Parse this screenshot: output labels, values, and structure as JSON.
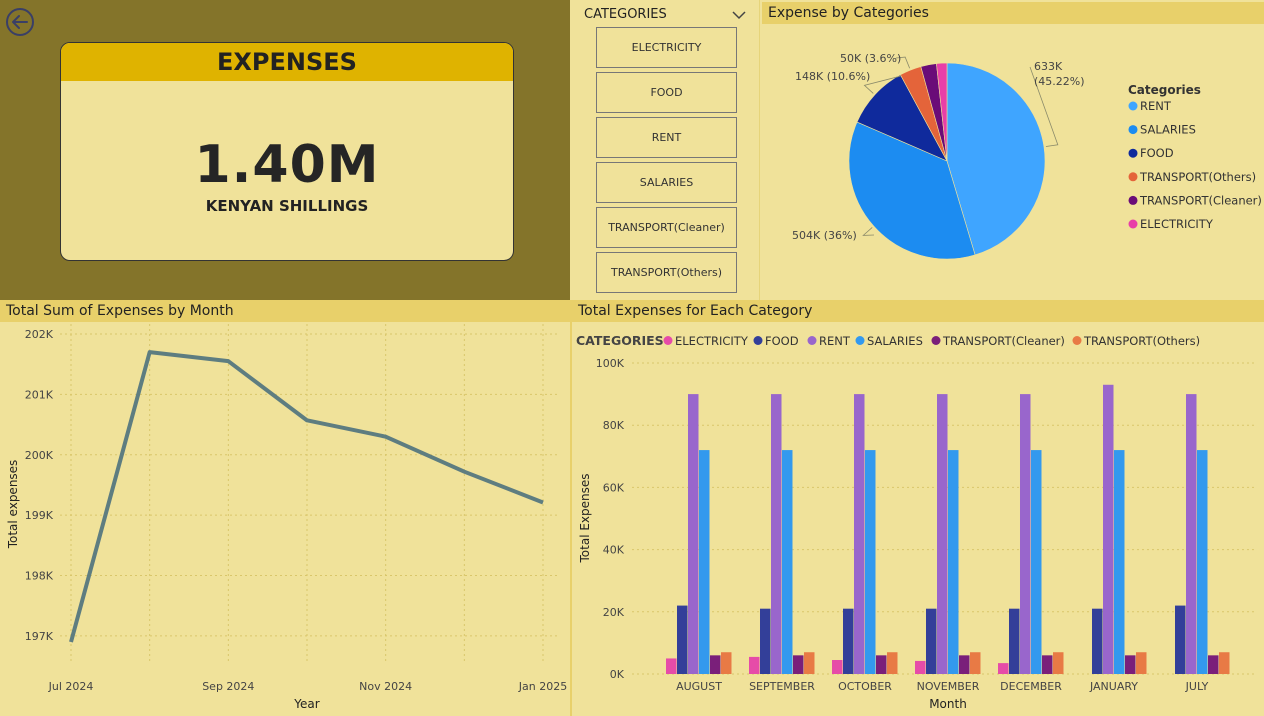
{
  "kpi": {
    "title": "EXPENSES",
    "value": "1.40M",
    "unit": "KENYAN SHILLINGS"
  },
  "slicer": {
    "title": "CATEGORIES",
    "items": [
      "ELECTRICITY",
      "FOOD",
      "RENT",
      "SALARIES",
      "TRANSPORT(Cleaner)",
      "TRANSPORT(Others)"
    ]
  },
  "icons": {
    "back": "back-arrow-icon",
    "chevron": "chevron-down-icon"
  },
  "colors": {
    "rent": "#9966cc",
    "salaries": "#3399ee",
    "food": "#333f99",
    "electricity": "#e64ca8",
    "transport_cleaner": "#7a1f7a",
    "transport_others": "#e87a45",
    "line": "#5e7d80",
    "pie_rent": "#3fa5ff",
    "pie_salaries": "#1c8cf1",
    "pie_food": "#0f2a9c",
    "pie_transport_others": "#e4643a",
    "pie_transport_cleaner": "#6a0c78",
    "pie_electricity": "#e83fa8"
  },
  "panels": {
    "pie_title": "Expense by Categories",
    "line_title": "Total Sum of Expenses by Month",
    "bar_title": "Total Expenses for Each Category"
  },
  "chart_data": [
    {
      "type": "pie",
      "title": "Expense by Categories",
      "legend_title": "Categories",
      "legend_position": "right",
      "slices": [
        {
          "name": "RENT",
          "value": 633,
          "label": "633K (45.22%)"
        },
        {
          "name": "SALARIES",
          "value": 504,
          "label": "504K (36%)"
        },
        {
          "name": "FOOD",
          "value": 148,
          "label": "148K (10.6%)"
        },
        {
          "name": "TRANSPORT(Others)",
          "value": 50,
          "label": "50K (3.6%)"
        },
        {
          "name": "TRANSPORT(Cleaner)",
          "value": 36,
          "label": ""
        },
        {
          "name": "ELECTRICITY",
          "value": 24,
          "label": ""
        }
      ]
    },
    {
      "type": "line",
      "title": "Total Sum of Expenses by Month",
      "xlabel": "Year",
      "ylabel": "Total expenses",
      "x_ticks": [
        "Jul 2024",
        "Sep 2024",
        "Nov 2024",
        "Jan 2025"
      ],
      "y_ticks": [
        "197K",
        "198K",
        "199K",
        "200K",
        "201K",
        "202K"
      ],
      "ylim": [
        196.8,
        202.0
      ],
      "x": [
        "2024-07",
        "2024-08",
        "2024-09",
        "2024-10",
        "2024-11",
        "2024-12",
        "2025-01"
      ],
      "y": [
        196.9,
        201.7,
        201.55,
        200.57,
        200.3,
        199.72,
        199.21
      ],
      "grid": true
    },
    {
      "type": "bar",
      "title": "Total Expenses for Each Category",
      "xlabel": "Month",
      "ylabel": "Total Expenses",
      "legend_title": "CATEGORIES",
      "legend_position": "top",
      "categories": [
        "AUGUST",
        "SEPTEMBER",
        "OCTOBER",
        "NOVEMBER",
        "DECEMBER",
        "JANUARY",
        "JULY"
      ],
      "y_ticks": [
        "0K",
        "20K",
        "40K",
        "60K",
        "80K",
        "100K"
      ],
      "ylim": [
        0,
        100
      ],
      "series": [
        {
          "name": "ELECTRICITY",
          "values": [
            5,
            5.5,
            4.5,
            4.2,
            3.5,
            0,
            0
          ]
        },
        {
          "name": "FOOD",
          "values": [
            22,
            21,
            21,
            21,
            21,
            21,
            22
          ]
        },
        {
          "name": "RENT",
          "values": [
            90,
            90,
            90,
            90,
            90,
            93,
            90
          ]
        },
        {
          "name": "SALARIES",
          "values": [
            72,
            72,
            72,
            72,
            72,
            72,
            72
          ]
        },
        {
          "name": "TRANSPORT(Cleaner)",
          "values": [
            6,
            6,
            6,
            6,
            6,
            6,
            6
          ]
        },
        {
          "name": "TRANSPORT(Others)",
          "values": [
            7,
            7,
            7,
            7,
            7,
            7,
            7
          ]
        }
      ],
      "grid": true
    }
  ]
}
